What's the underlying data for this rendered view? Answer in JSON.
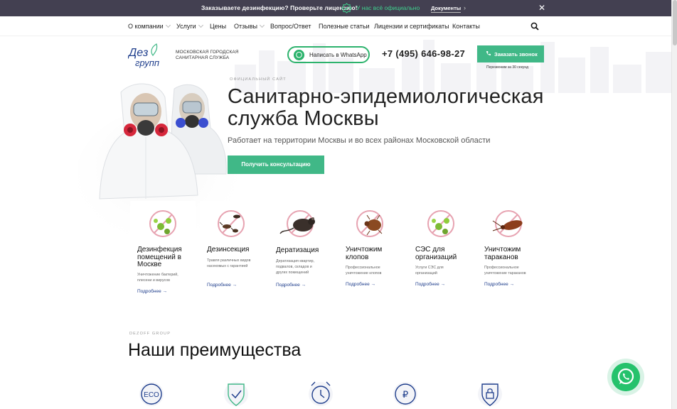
{
  "topbar": {
    "question": "Заказываете дезинфекцию? Проверьте лицензию!",
    "official": "У нас всё официально",
    "documents": "Документы",
    "arrow": "›",
    "close": "✕"
  },
  "nav": {
    "items": [
      {
        "label": "О компании",
        "dropdown": true
      },
      {
        "label": "Услуги",
        "dropdown": true
      },
      {
        "label": "Цены",
        "dropdown": false
      },
      {
        "label": "Отзывы",
        "dropdown": true
      },
      {
        "label": "Вопрос/Ответ",
        "dropdown": false
      },
      {
        "label": "Полезные статьи",
        "dropdown": false
      },
      {
        "label": "Лицензии и сертификаты",
        "dropdown": false
      },
      {
        "label": "Контакты",
        "dropdown": false
      }
    ],
    "search_icon": "search-icon"
  },
  "header": {
    "logo_line1": "Дез",
    "logo_line2": "групп",
    "logo_sub_line1": "МОСКОВСКАЯ ГОРОДСКАЯ",
    "logo_sub_line2": "САНИТАРНАЯ СЛУЖБА",
    "whatsapp_label": "Написать в WhatsApp",
    "phone": "+7 (495) 646-98-27",
    "call_label": "Заказать звонок",
    "call_note": "Перезвоним за 30 секунд"
  },
  "hero": {
    "sup": "ОФИЦИАЛЬНЫЙ САЙТ",
    "title_line1": "Санитарно-эпидемиологическая",
    "title_line2": "служба Москвы",
    "subtitle": "Работает на территории Москвы и во всех районах Московской области",
    "button": "Получить консультацию"
  },
  "services": [
    {
      "title": [
        "Дезинфекция",
        "помещений в",
        "Москве"
      ],
      "desc": [
        "Уничтожение бактерий,",
        "плесени и вирусов"
      ],
      "more": "Подробнее →",
      "icon": "bacteria-icon"
    },
    {
      "title": [
        "Дезинсекция"
      ],
      "desc": [
        "Травля различных видов",
        "насекомых с гарантией"
      ],
      "more": "Подробнее →",
      "icon": "insects-icon"
    },
    {
      "title": [
        "Дератизация"
      ],
      "desc": [
        "Дератизация квартир,",
        "подвалов, складов и",
        "других помещений"
      ],
      "more": "Подробнее →",
      "icon": "rat-icon"
    },
    {
      "title": [
        "Уничтожим",
        "клопов"
      ],
      "desc": [
        "Профессиональное",
        "уничтожение клопов"
      ],
      "more": "Подробнее →",
      "icon": "bedbug-icon"
    },
    {
      "title": [
        "СЭС для",
        "организаций"
      ],
      "desc": [
        "Услуги СЭС для",
        "организаций"
      ],
      "more": "Подробнее →",
      "icon": "bacteria-icon"
    },
    {
      "title": [
        "Уничтожим",
        "тараканов"
      ],
      "desc": [
        "Профессиональное",
        "уничтожение тараканов"
      ],
      "more": "Подробнее →",
      "icon": "cockroach-icon"
    }
  ],
  "advantages": {
    "sup": "DEZOFF GROUP",
    "title": "Наши преимущества",
    "icon_eco": "ECO",
    "icon_ruble": "₽"
  },
  "colors": {
    "topbar_bg": "#434051",
    "accent": "#40b887",
    "link": "#1f3e8c",
    "official_text": "#3fcf8e"
  }
}
